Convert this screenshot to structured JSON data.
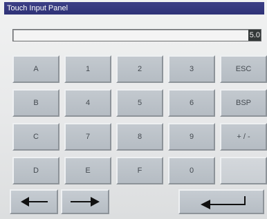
{
  "window": {
    "title": "Touch Input Panel"
  },
  "display": {
    "value": "5.0"
  },
  "keys": [
    [
      "A",
      "1",
      "2",
      "3",
      "ESC"
    ],
    [
      "B",
      "4",
      "5",
      "6",
      "BSP"
    ],
    [
      "C",
      "7",
      "8",
      "9",
      "+ / -"
    ],
    [
      "D",
      "E",
      "F",
      "0",
      ""
    ]
  ],
  "navigation": {
    "left_icon": "arrow-left-icon",
    "right_icon": "arrow-right-icon",
    "enter_icon": "enter-arrow-icon"
  },
  "colors": {
    "titlebar": "#2f3277",
    "key_face": "#bcc2c9",
    "key_text": "#444a50",
    "background": "#e8eaeb"
  }
}
